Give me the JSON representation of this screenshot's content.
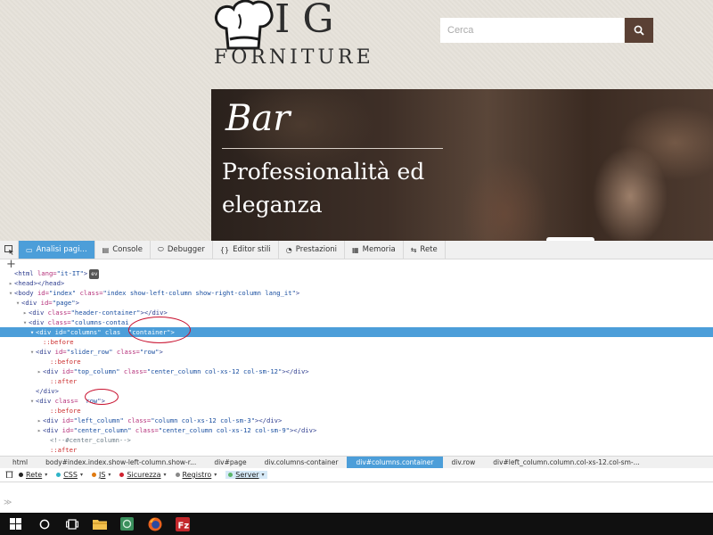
{
  "site": {
    "logo_top": "IG",
    "logo_bottom": "FORNITURE",
    "search_placeholder": "Cerca",
    "banner_title": "Bar",
    "banner_subtitle": "Professionalità ed eleganza"
  },
  "devtools": {
    "tabs": [
      {
        "label": "Analisi pagi...",
        "icon": "inspector-icon",
        "active": true
      },
      {
        "label": "Console",
        "icon": "console-icon"
      },
      {
        "label": "Debugger",
        "icon": "debugger-icon"
      },
      {
        "label": "Editor stili",
        "icon": "style-editor-icon"
      },
      {
        "label": "Prestazioni",
        "icon": "performance-icon"
      },
      {
        "label": "Memoria",
        "icon": "memory-icon"
      },
      {
        "label": "Rete",
        "icon": "network-icon"
      }
    ],
    "markup": [
      {
        "i": 0,
        "tw": "",
        "parts": [
          [
            "tag",
            "<html "
          ],
          [
            "attr",
            "lang="
          ],
          [
            "val",
            "\"it-IT\""
          ],
          [
            "tag",
            ">"
          ]
        ],
        "badge": "ev"
      },
      {
        "i": 0,
        "tw": "▸",
        "parts": [
          [
            "tag",
            "<head></head>"
          ]
        ]
      },
      {
        "i": 0,
        "tw": "▾",
        "parts": [
          [
            "tag",
            "<body "
          ],
          [
            "attr",
            "id="
          ],
          [
            "val",
            "\"index\" "
          ],
          [
            "attr",
            "class="
          ],
          [
            "val",
            "\"index show-left-column show-right-column lang_it\""
          ],
          [
            "tag",
            ">"
          ]
        ]
      },
      {
        "i": 1,
        "tw": "▾",
        "parts": [
          [
            "tag",
            "<div "
          ],
          [
            "attr",
            "id="
          ],
          [
            "val",
            "\"page\""
          ],
          [
            "tag",
            ">"
          ]
        ]
      },
      {
        "i": 2,
        "tw": "▸",
        "parts": [
          [
            "tag",
            "<div "
          ],
          [
            "attr",
            "class="
          ],
          [
            "val",
            "\"header-container\""
          ],
          [
            "tag",
            "></div>"
          ]
        ]
      },
      {
        "i": 2,
        "tw": "▾",
        "parts": [
          [
            "tag",
            "<div "
          ],
          [
            "attr",
            "class="
          ],
          [
            "val",
            "\"columns-contai"
          ]
        ]
      },
      {
        "i": 3,
        "tw": "▾",
        "sel": true,
        "parts": [
          [
            "tag",
            "<div "
          ],
          [
            "attr",
            "id="
          ],
          [
            "val",
            "\"columns\" "
          ],
          [
            "attr",
            "clas"
          ],
          [
            "val",
            "  \"container\""
          ],
          [
            "tag",
            ">"
          ]
        ]
      },
      {
        "i": 4,
        "tw": "",
        "parts": [
          [
            "pseudo",
            "::before"
          ]
        ]
      },
      {
        "i": 3,
        "tw": "▾",
        "parts": [
          [
            "tag",
            "<div "
          ],
          [
            "attr",
            "id="
          ],
          [
            "val",
            "\"slider_row\" "
          ],
          [
            "attr",
            "class="
          ],
          [
            "val",
            "\"row\""
          ],
          [
            "tag",
            ">"
          ]
        ]
      },
      {
        "i": 5,
        "tw": "",
        "parts": [
          [
            "pseudo",
            "::before"
          ]
        ]
      },
      {
        "i": 4,
        "tw": "▸",
        "parts": [
          [
            "tag",
            "<div "
          ],
          [
            "attr",
            "id="
          ],
          [
            "val",
            "\"top_column\" "
          ],
          [
            "attr",
            "class="
          ],
          [
            "val",
            "\"center_column col-xs-12 col-sm-12\""
          ],
          [
            "tag",
            "></div>"
          ]
        ]
      },
      {
        "i": 5,
        "tw": "",
        "parts": [
          [
            "pseudo",
            "::after"
          ]
        ]
      },
      {
        "i": 3,
        "tw": "",
        "parts": [
          [
            "tag",
            "</div>"
          ]
        ]
      },
      {
        "i": 3,
        "tw": "▾",
        "parts": [
          [
            "tag",
            "<div "
          ],
          [
            "attr",
            "class="
          ],
          [
            "val",
            "  row"
          ],
          [
            "tag",
            "\">"
          ]
        ]
      },
      {
        "i": 5,
        "tw": "",
        "parts": [
          [
            "pseudo",
            "::before"
          ]
        ]
      },
      {
        "i": 4,
        "tw": "▸",
        "parts": [
          [
            "tag",
            "<div "
          ],
          [
            "attr",
            "id="
          ],
          [
            "val",
            "\"left_column\" "
          ],
          [
            "attr",
            "class="
          ],
          [
            "val",
            "\"column col-xs-12 col-sm-3\""
          ],
          [
            "tag",
            "></div>"
          ]
        ]
      },
      {
        "i": 4,
        "tw": "▸",
        "parts": [
          [
            "tag",
            "<div "
          ],
          [
            "attr",
            "id="
          ],
          [
            "val",
            "\"center_column\" "
          ],
          [
            "attr",
            "class="
          ],
          [
            "val",
            "\"center_column col-xs-12 col-sm-9\""
          ],
          [
            "tag",
            "></div>"
          ]
        ]
      },
      {
        "i": 5,
        "tw": "",
        "parts": [
          [
            "comment",
            "<!--#center_column-->"
          ]
        ]
      },
      {
        "i": 5,
        "tw": "",
        "parts": [
          [
            "pseudo",
            "::after"
          ]
        ]
      },
      {
        "i": 4,
        "tw": "",
        "parts": [
          [
            "tag",
            "</div>"
          ]
        ]
      }
    ],
    "breadcrumbs": [
      {
        "label": "html"
      },
      {
        "label": "body#index.index.show-left-column.show-r..."
      },
      {
        "label": "div#page"
      },
      {
        "label": "div.columns-container"
      },
      {
        "label": "div#columns.container",
        "active": true
      },
      {
        "label": "div.row"
      },
      {
        "label": "div#left_column.column.col-xs-12.col-sm-..."
      }
    ],
    "console_filters": [
      {
        "label": "Rete",
        "color": "#222222"
      },
      {
        "label": "CSS",
        "color": "#2fb4c8"
      },
      {
        "label": "JS",
        "color": "#e07a10"
      },
      {
        "label": "Sicurezza",
        "color": "#d0212e"
      },
      {
        "label": "Registro",
        "color": "#888888"
      },
      {
        "label": "Server",
        "color": "#5bb569",
        "active": true
      }
    ],
    "console_prompt": "≫"
  },
  "taskbar": {
    "items": [
      "windows-start-icon",
      "cortana-icon",
      "task-view-icon",
      "file-explorer-icon",
      "app-icon",
      "firefox-icon",
      "filezilla-icon"
    ]
  },
  "colors": {
    "accent_blue": "#4c9ed9",
    "search_button": "#5a4034",
    "annotation_red": "#c8102e"
  }
}
